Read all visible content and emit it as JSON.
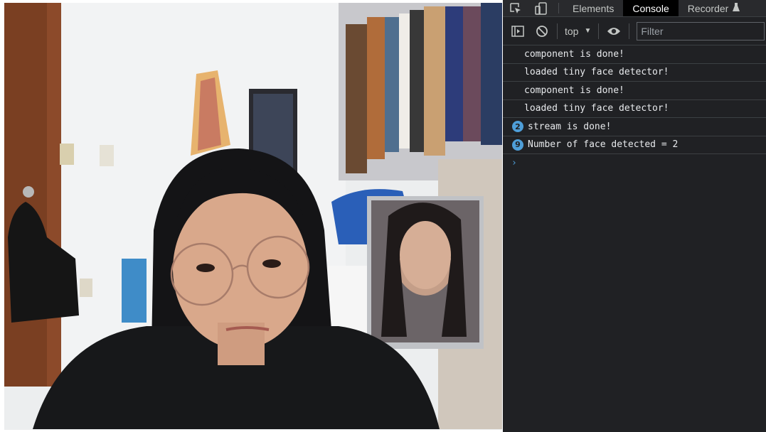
{
  "devtools": {
    "tabs": [
      {
        "label": "Elements",
        "active": false
      },
      {
        "label": "Console",
        "active": true
      },
      {
        "label": "Recorder",
        "active": false
      }
    ],
    "toolbar": {
      "context": "top",
      "filter_placeholder": "Filter"
    },
    "console": {
      "messages": [
        {
          "count": "",
          "text": "component is done!"
        },
        {
          "count": "",
          "text": "loaded tiny face detector!"
        },
        {
          "count": "",
          "text": "component is done!"
        },
        {
          "count": "",
          "text": "loaded tiny face detector!"
        },
        {
          "count": "2",
          "text": "stream is done!"
        },
        {
          "count": "9",
          "text": "Number of face detected = 2"
        }
      ],
      "prompt": "›"
    },
    "colors": {
      "panel_bg": "#202124",
      "badge": "#4e9ed8",
      "active_tab": "#000000"
    }
  },
  "webcam": {
    "icons": [
      "webcam-video-feed"
    ]
  }
}
